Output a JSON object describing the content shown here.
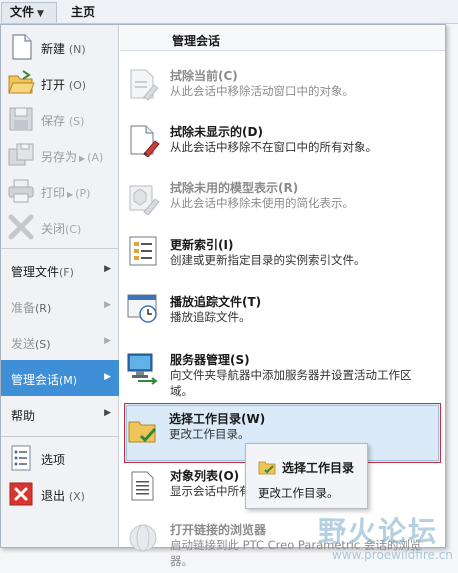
{
  "tabs": {
    "file": "文件",
    "home": "主页"
  },
  "left_items": [
    {
      "label": "新建",
      "shortcut": "(N)",
      "icon": "new-document-icon",
      "disabled": false
    },
    {
      "label": "打开",
      "shortcut": "(O)",
      "icon": "open-folder-icon",
      "disabled": false
    },
    {
      "label": "保存",
      "shortcut": "(S)",
      "icon": "save-icon",
      "disabled": true
    },
    {
      "label": "另存为",
      "shortcut": "(A)",
      "icon": "save-as-icon",
      "disabled": true
    },
    {
      "label": "打印",
      "shortcut": "(P)",
      "icon": "print-icon",
      "disabled": true
    },
    {
      "label": "关闭",
      "shortcut": "(C)",
      "icon": "close-x-icon",
      "disabled": true
    }
  ],
  "left_submenus": [
    {
      "label": "管理文件",
      "shortcut": "(F)",
      "disabled": false,
      "selected": false
    },
    {
      "label": "准备",
      "shortcut": "(R)",
      "disabled": true,
      "selected": false
    },
    {
      "label": "发送",
      "shortcut": "(S)",
      "disabled": true,
      "selected": false
    },
    {
      "label": "管理会话",
      "shortcut": "(M)",
      "disabled": false,
      "selected": true
    },
    {
      "label": "帮助",
      "shortcut": "",
      "disabled": false,
      "selected": false
    }
  ],
  "left_bottom": [
    {
      "label": "选项",
      "shortcut": "",
      "icon": "options-list-icon"
    },
    {
      "label": "退出",
      "shortcut": "(X)",
      "icon": "exit-icon"
    }
  ],
  "panel": {
    "title": "管理会话",
    "items": [
      {
        "title": "拭除当前(C)",
        "desc": "从此会话中移除活动窗口中的对象。",
        "icon": "erase-current-icon",
        "disabled": true
      },
      {
        "title": "拭除未显示的(D)",
        "desc": "从此会话中移除不在窗口中的所有对象。",
        "icon": "erase-not-displayed-icon",
        "disabled": false
      },
      {
        "title": "拭除未用的模型表示(R)",
        "desc": "从此会话中移除未使用的简化表示。",
        "icon": "erase-unused-reps-icon",
        "disabled": true
      },
      {
        "title": "更新索引(I)",
        "desc": "创建或更新指定目录的实例索引文件。",
        "icon": "update-index-icon",
        "disabled": false
      },
      {
        "title": "播放追踪文件(T)",
        "desc": "播放追踪文件。",
        "icon": "play-trail-icon",
        "disabled": false
      },
      {
        "title": "服务器管理(S)",
        "desc": "向文件夹导航器中添加服务器并设置活动工作区域。",
        "icon": "server-management-icon",
        "disabled": false
      },
      {
        "title": "选择工作目录(W)",
        "desc": "更改工作目录。",
        "icon": "working-directory-icon",
        "disabled": false
      },
      {
        "title": "对象列表(O)",
        "desc": "显示会话中所有",
        "icon": "object-list-icon",
        "disabled": false
      },
      {
        "title": "打开链接的浏览器",
        "desc": "启动链接到此 PTC Creo Parametric 会话的浏览器。",
        "icon": "linked-browser-icon",
        "disabled": true
      }
    ]
  },
  "tooltip": {
    "title": "选择工作目录",
    "desc": "更改工作目录。"
  },
  "watermark": {
    "text": "野火论坛",
    "url": "www.proewildfire.cn"
  },
  "colors": {
    "selected": "#3f8fd6",
    "highlight_border": "#c22f3d",
    "highlight_bg": "#dbeaf8"
  }
}
